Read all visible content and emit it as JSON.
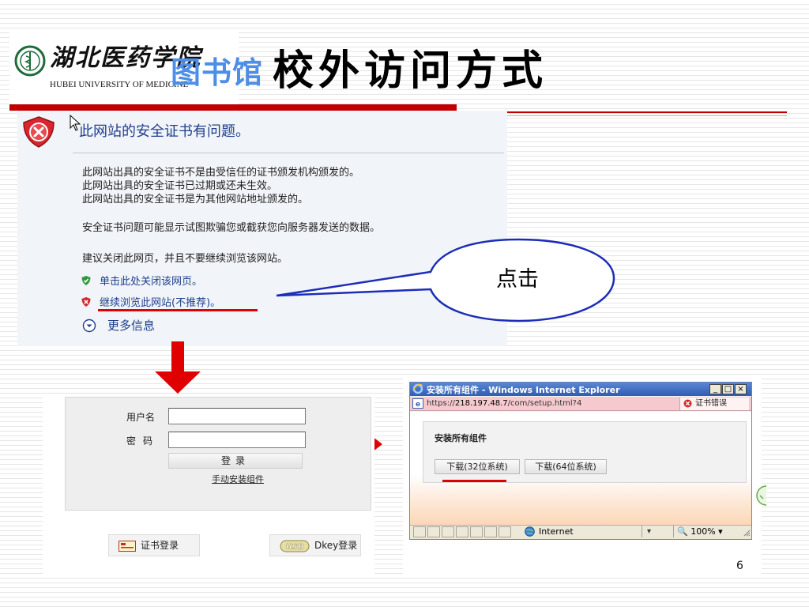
{
  "header": {
    "university_cn": "湖北医药学院",
    "university_en": "HUBEI UNIVERSITY OF MEDICINE",
    "library_label": "图书馆",
    "slide_title": "校外访问方式"
  },
  "cert_warning": {
    "heading": "此网站的安全证书有问题。",
    "lines": [
      "此网站出具的安全证书不是由受信任的证书颁发机构颁发的。",
      "此网站出具的安全证书已过期或还未生效。",
      "此网站出具的安全证书是为其他网站地址颁发的。",
      "安全证书问题可能显示试图欺骗您或截获您向服务器发送的数据。",
      "建议关闭此网页，并且不要继续浏览该网站。"
    ],
    "close_link": "单击此处关闭该网页。",
    "continue_link": "继续浏览此网站(不推荐)。",
    "more_info": "更多信息",
    "colors": {
      "link": "#1f3f8c",
      "error_red": "#d9262e",
      "ok_green": "#2f9a3c"
    }
  },
  "callout": {
    "label": "点击"
  },
  "login_form": {
    "username_label": "用户名",
    "username_value": "",
    "password_label": "密码",
    "password_value": "",
    "login_button": "登录",
    "manual_install_link": "手动安装组件",
    "cert_login_button": "证书登录",
    "dkey_login_button": "Dkey登录",
    "usb_badge": "USB"
  },
  "ie_window": {
    "title": "安装所有组件 - Windows Internet Explorer",
    "url_scheme": "https://",
    "url_host": "218.197.48.7",
    "url_path": "/com/setup.html?4",
    "cert_error_label": "证书错误",
    "content_heading": "安装所有组件",
    "download_32": "下载(32位系统)",
    "download_64": "下载(64位系统)",
    "status_zone": "Internet",
    "zoom": "100%"
  },
  "page_number": "6",
  "accent_colors": {
    "title_bar_red": "#c00000",
    "arrow_red": "#e00000",
    "ie_blue": "#2f5db3"
  }
}
